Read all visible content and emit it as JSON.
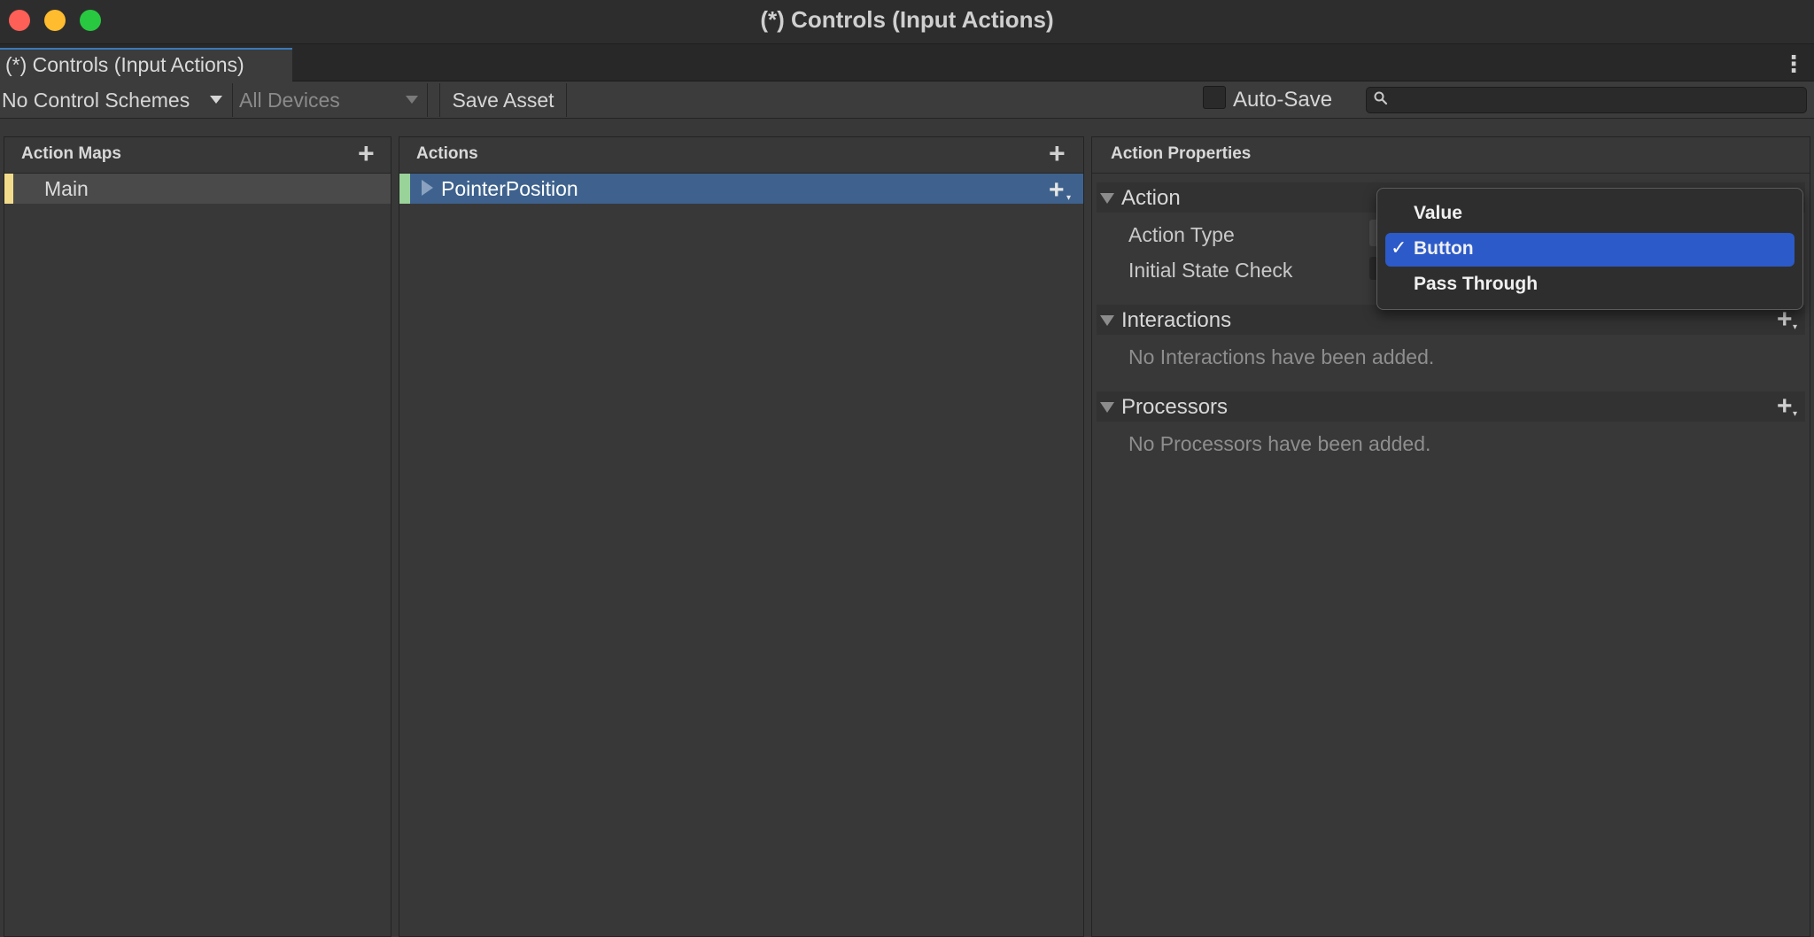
{
  "window": {
    "title": "(*) Controls (Input Actions)"
  },
  "tab": {
    "label": "(*) Controls (Input Actions)"
  },
  "toolbar": {
    "control_scheme": "No Control Schemes",
    "devices": "All Devices",
    "save_label": "Save Asset",
    "autosave_label": "Auto-Save",
    "autosave_checked": false,
    "search_value": ""
  },
  "action_maps": {
    "header": "Action Maps",
    "items": [
      {
        "label": "Main",
        "stripe_color": "#f2dc8b",
        "selected": true
      }
    ]
  },
  "actions": {
    "header": "Actions",
    "items": [
      {
        "label": "PointerPosition",
        "stripe_color": "#9ad39a",
        "selected": true
      }
    ]
  },
  "properties": {
    "header": "Action Properties",
    "action_section": {
      "title": "Action",
      "fields": [
        {
          "label": "Action Type"
        },
        {
          "label": "Initial State Check"
        }
      ]
    },
    "interactions": {
      "title": "Interactions",
      "empty_text": "No Interactions have been added."
    },
    "processors": {
      "title": "Processors",
      "empty_text": "No Processors have been added."
    }
  },
  "action_type_popup": {
    "options": [
      "Value",
      "Button",
      "Pass Through"
    ],
    "selected": "Button",
    "check_glyph": "✓",
    "highlight_color": "#2c5ac9"
  },
  "colors": {
    "accent": "#3a79bb",
    "selection_row": "#3e628d",
    "close": "#fe5f57",
    "minimize": "#febc2e",
    "maximize": "#28c840"
  }
}
